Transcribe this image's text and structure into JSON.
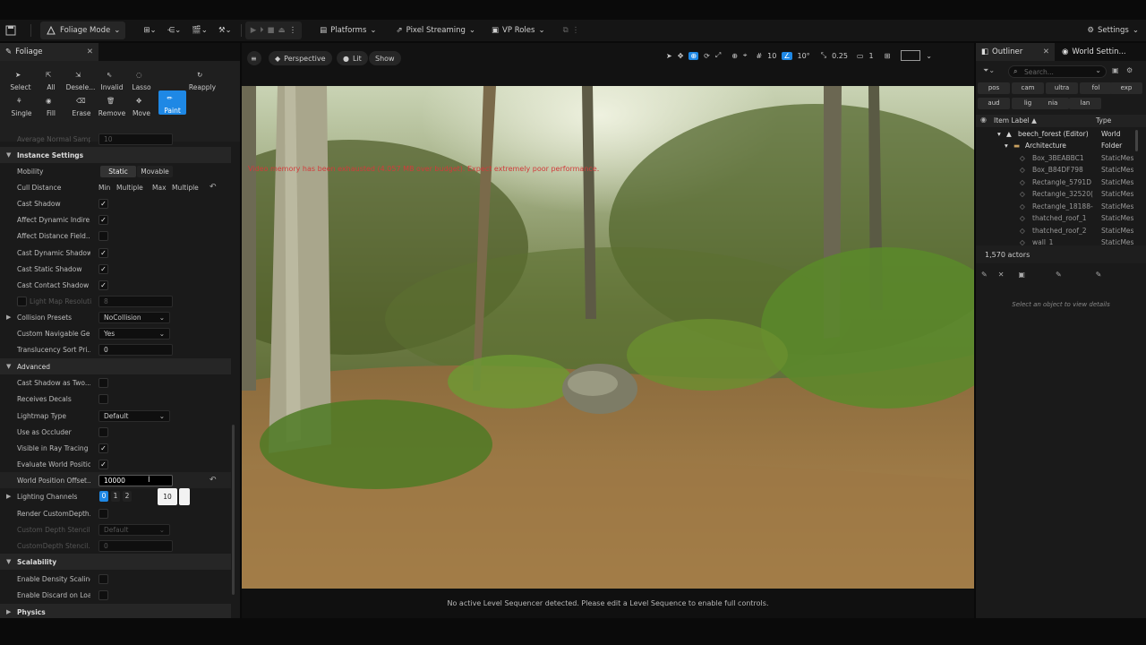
{
  "toolbar": {
    "mode_label": "Foliage Mode",
    "platforms_label": "Platforms",
    "pixel_streaming_label": "Pixel Streaming",
    "vp_roles_label": "VP Roles",
    "settings_label": "Settings"
  },
  "foliage_panel": {
    "tab_label": "Foliage",
    "tools": [
      {
        "label": "Select",
        "icon": "cursor-icon"
      },
      {
        "label": "All",
        "icon": "select-all-icon"
      },
      {
        "label": "Desele...",
        "icon": "deselect-icon"
      },
      {
        "label": "Invalid",
        "icon": "invalid-icon"
      },
      {
        "label": "Lasso",
        "icon": "lasso-icon"
      },
      {
        "label": "Paint",
        "icon": "brush-icon"
      },
      {
        "label": "Reapply",
        "icon": "reapply-icon"
      },
      {
        "label": "Single",
        "icon": "single-icon"
      },
      {
        "label": "Fill",
        "icon": "fill-icon"
      },
      {
        "label": "Erase",
        "icon": "eraser-icon"
      },
      {
        "label": "Remove",
        "icon": "trash-icon"
      },
      {
        "label": "Move",
        "icon": "move-icon"
      }
    ],
    "avg_normal_label": "Average Normal Samp...",
    "avg_normal_value": "10",
    "instance_settings_label": "Instance Settings",
    "mobility_label": "Mobility",
    "mobility_static": "Static",
    "mobility_movable": "Movable",
    "cull_distance_label": "Cull Distance",
    "cull_min_label": "Min",
    "cull_min_value": "Multiple",
    "cull_max_label": "Max",
    "cull_max_value": "Multiple",
    "cast_shadow_label": "Cast Shadow",
    "affect_dyn_indirect_label": "Affect Dynamic Indire...",
    "affect_distance_field_label": "Affect Distance Field...",
    "cast_dynamic_shadow_label": "Cast Dynamic Shadow",
    "cast_static_shadow_label": "Cast Static Shadow",
    "cast_contact_shadow_label": "Cast Contact Shadow",
    "light_map_res_label": "Light Map Resoluti...",
    "light_map_res_value": "8",
    "collision_presets_label": "Collision Presets",
    "collision_presets_value": "NoCollision",
    "custom_nav_label": "Custom Navigable Ge...",
    "custom_nav_value": "Yes",
    "translucency_label": "Translucency Sort Pri...",
    "translucency_value": "0",
    "advanced_label": "Advanced",
    "cast_shadow_two_label": "Cast Shadow as Two...",
    "receives_decals_label": "Receives Decals",
    "lightmap_type_label": "Lightmap Type",
    "lightmap_type_value": "Default",
    "use_occluder_label": "Use as Occluder",
    "visible_ray_label": "Visible in Ray Tracing",
    "evaluate_wpo_label": "Evaluate World Positio...",
    "wpo_label": "World Position Offset...",
    "wpo_value": "10000",
    "lighting_channels_label": "Lighting Channels",
    "channel_0": "0",
    "channel_1": "1",
    "channel_2": "2",
    "tooltip_value": "10",
    "render_custom_depth_label": "Render CustomDepth...",
    "custom_depth_stencil_label": "Custom Depth Stencil...",
    "custom_depth_stencil_value": "Default",
    "custom_depth_stencil2_label": "CustomDepth Stencil...",
    "custom_depth_stencil2_value": "0",
    "scalability_label": "Scalability",
    "enable_density_label": "Enable Density Scaling",
    "enable_discard_label": "Enable Discard on Load",
    "physics_label": "Physics"
  },
  "viewport": {
    "perspective_label": "Perspective",
    "lit_label": "Lit",
    "show_label": "Show",
    "grid_value": "10",
    "angle_value": "10°",
    "scale_value": "0.25",
    "camera_speed": "1",
    "warning_text": "Video memory has been exhausted (4.057 MB over budget). Expect extremely poor performance.",
    "status_text": "No active Level Sequencer detected. Please edit a Level Sequence to enable full controls."
  },
  "outliner": {
    "tab_label": "Outliner",
    "world_settings_label": "World Settin...",
    "search_placeholder": "Search...",
    "chips": [
      "pos",
      "cam",
      "ultra",
      "fol",
      "exp",
      "aud",
      "lig",
      "nia",
      "lan"
    ],
    "col_item_label": "Item Label ▲",
    "col_type": "Type",
    "rows": [
      {
        "name": "beech_forest (Editor)",
        "type": "World"
      },
      {
        "name": "Architecture",
        "type": "Folder"
      },
      {
        "name": "Box_3BEABBC1",
        "type": "StaticMes"
      },
      {
        "name": "Box_B84DF798",
        "type": "StaticMes"
      },
      {
        "name": "Rectangle_5791D",
        "type": "StaticMes"
      },
      {
        "name": "Rectangle_32520(",
        "type": "StaticMes"
      },
      {
        "name": "Rectangle_18188-",
        "type": "StaticMes"
      },
      {
        "name": "thatched_roof_1",
        "type": "StaticMes"
      },
      {
        "name": "thatched_roof_2",
        "type": "StaticMes"
      },
      {
        "name": "wall_1",
        "type": "StaticMes"
      }
    ],
    "actor_count": "1,570 actors",
    "details_hint": "Select an object to view details"
  },
  "colors": {
    "accent": "#1e88e5",
    "warning": "#d23b3b"
  }
}
